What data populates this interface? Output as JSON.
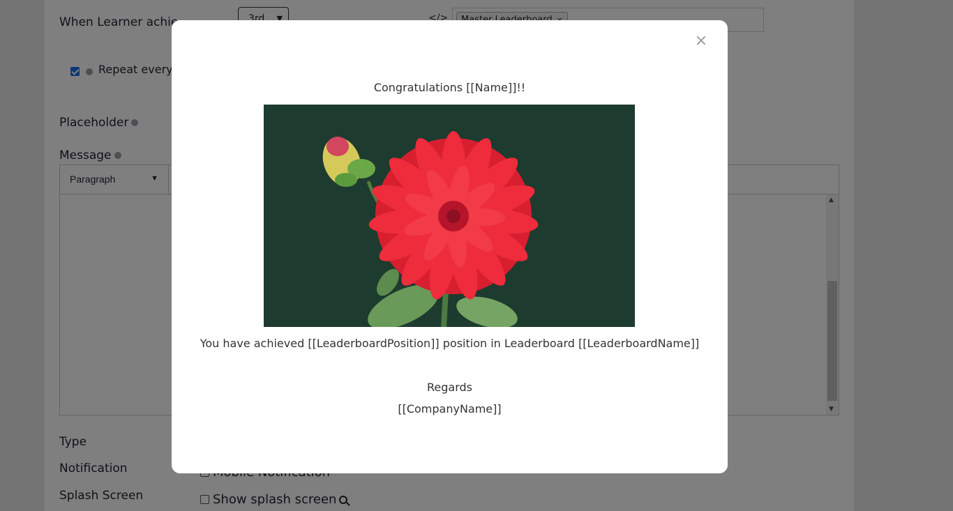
{
  "form": {
    "when_label": "When Learner achie",
    "position_value": "3rd",
    "code_glyph": "</>",
    "leaderboard_tag": "Master Leaderboard",
    "tag_remove": "×",
    "repeat_label": "Repeat every",
    "placeholder_label": "Placeholder",
    "message_label": "Message",
    "editor_block": "Paragraph",
    "type_label": "Type",
    "notification_label": "Notification",
    "mobile_notification_label": "Mobile Notification",
    "splash_label": "Splash Screen",
    "show_splash_label": "Show splash screen"
  },
  "modal": {
    "close": "×",
    "heading": "Congratulations [[Name]]!!",
    "body": "You have achieved [[LeaderboardPosition]] position in Leaderboard [[LeaderboardName]]",
    "regards": "Regards",
    "company": "[[CompanyName]]"
  },
  "colors": {
    "image_background": "#1e3b2f",
    "flower_petal": "#e8283a",
    "overlay": "rgba(0,0,0,0.5)"
  }
}
